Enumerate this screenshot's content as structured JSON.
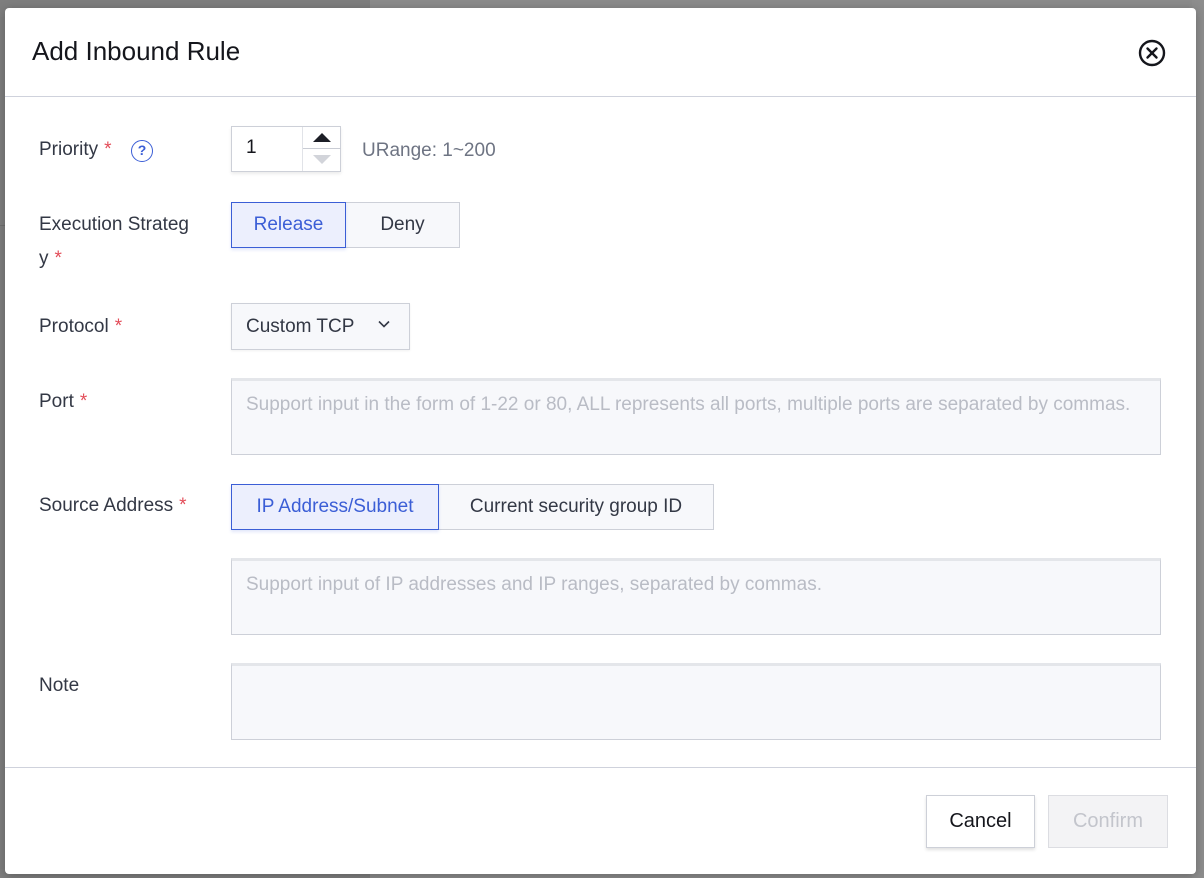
{
  "dialog": {
    "title": "Add Inbound Rule"
  },
  "form": {
    "priority": {
      "label": "Priority",
      "required_mark": "*",
      "help_icon": "question-circle-icon",
      "value": "1",
      "range_hint": "URange: 1~200"
    },
    "execution_strategy": {
      "label_line1": "Execution Strateg",
      "label_line2": "y",
      "required_mark": "*",
      "options": [
        "Release",
        "Deny"
      ],
      "selected": "Release"
    },
    "protocol": {
      "label": "Protocol",
      "required_mark": "*",
      "value": "Custom TCP"
    },
    "port": {
      "label": "Port",
      "required_mark": "*",
      "placeholder": "Support input in the form of 1-22 or 80, ALL represents all ports, multiple ports are separated by commas."
    },
    "source_address": {
      "label": "Source Address",
      "required_mark": "*",
      "options": [
        "IP Address/Subnet",
        "Current security group ID"
      ],
      "selected": "IP Address/Subnet",
      "placeholder": "Support input of IP addresses and IP ranges, separated by commas."
    },
    "note": {
      "label": "Note",
      "placeholder": ""
    }
  },
  "footer": {
    "cancel_label": "Cancel",
    "confirm_label": "Confirm"
  },
  "colors": {
    "accent": "#3b5ed6",
    "required": "#e34d59",
    "placeholder": "#b9bcc5"
  }
}
